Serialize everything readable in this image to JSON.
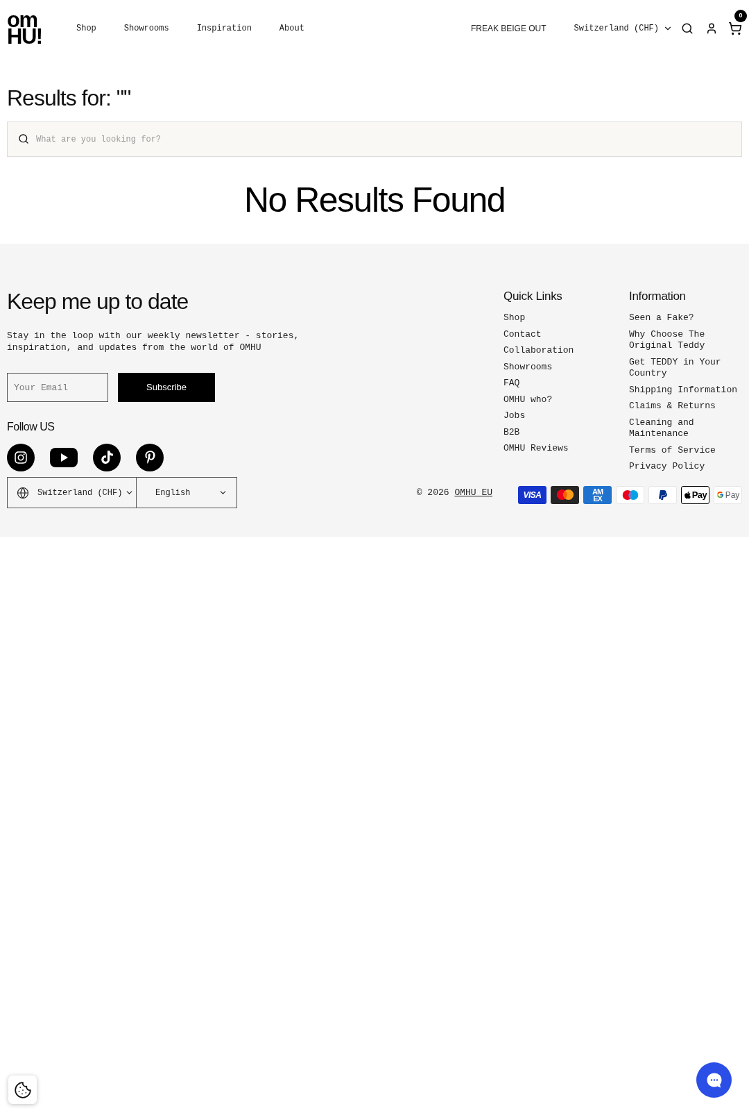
{
  "header": {
    "logo": [
      "om",
      "HU!"
    ],
    "nav": [
      "Shop",
      "Showrooms",
      "Inspiration",
      "About"
    ],
    "promo": "FREAK BEIGE OUT",
    "country": "Switzerland (CHF)",
    "cart_count": "0"
  },
  "search": {
    "heading": "Results for: \"\"",
    "placeholder": "What are you looking for?",
    "empty_message": "No Results Found"
  },
  "footer": {
    "newsletter": {
      "title": "Keep me up to date",
      "text": "Stay in the loop with our weekly newsletter - stories, inspiration, and updates from the world of OMHU",
      "email_placeholder": "Your Email",
      "button": "Subscribe"
    },
    "follow": {
      "title": "Follow US",
      "socials": [
        {
          "kind": "instagram"
        },
        {
          "kind": "youtube"
        },
        {
          "kind": "tiktok"
        },
        {
          "kind": "pinterest"
        }
      ]
    },
    "selectors": {
      "country": "Switzerland (CHF)",
      "language": "English"
    },
    "columns": [
      {
        "title": "Quick Links",
        "items": [
          "Shop",
          "Contact",
          "Collaboration",
          "Showrooms",
          "FAQ",
          "OMHU who?",
          "Jobs",
          "B2B",
          "OMHU Reviews"
        ]
      },
      {
        "title": "Information",
        "items": [
          "Seen a Fake?",
          "Why Choose The Original Teddy",
          "Get TEDDY in Your Country",
          "Shipping Information",
          "Claims & Returns",
          "Cleaning and Maintenance",
          "Terms of Service",
          "Privacy Policy"
        ]
      }
    ],
    "copyright": {
      "text": "© 2026",
      "link": "OMHU EU"
    },
    "payments": [
      {
        "kind": "visa",
        "label": "VISA"
      },
      {
        "kind": "mastercard"
      },
      {
        "kind": "amex",
        "label": "AM EX"
      },
      {
        "kind": "maestro"
      },
      {
        "kind": "paypal"
      },
      {
        "kind": "applepay",
        "label": "Pay"
      },
      {
        "kind": "googlepay",
        "label": "Pay"
      }
    ]
  }
}
